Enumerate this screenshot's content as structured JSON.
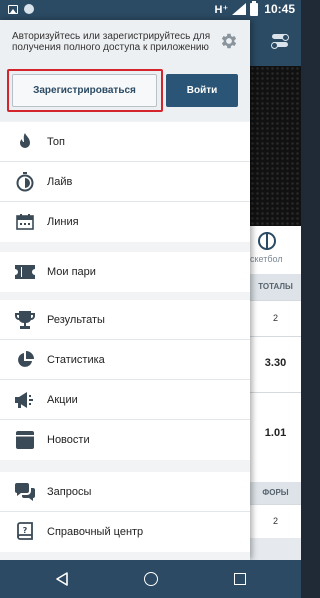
{
  "status_bar": {
    "network": "H⁺",
    "time": "10:45"
  },
  "drawer": {
    "auth_message": "Авторизуйтесь или зарегистрируйтесь для получения полного доступа к приложению",
    "register_label": "Зарегистрироваться",
    "login_label": "Войти",
    "groups": [
      {
        "items": [
          {
            "label": "Топ",
            "icon": "fire-icon"
          },
          {
            "label": "Лайв",
            "icon": "stopwatch-icon"
          },
          {
            "label": "Линия",
            "icon": "calendar-icon"
          }
        ]
      },
      {
        "items": [
          {
            "label": "Мои пари",
            "icon": "ticket-icon"
          }
        ]
      },
      {
        "items": [
          {
            "label": "Результаты",
            "icon": "trophy-icon"
          },
          {
            "label": "Статистика",
            "icon": "pie-chart-icon"
          },
          {
            "label": "Акции",
            "icon": "megaphone-icon"
          },
          {
            "label": "Новости",
            "icon": "newspaper-icon"
          }
        ]
      },
      {
        "items": [
          {
            "label": "Запросы",
            "icon": "chat-icon"
          },
          {
            "label": "Справочный центр",
            "icon": "help-book-icon"
          }
        ]
      }
    ]
  },
  "background": {
    "sport_label": "скетбол",
    "col_header": "ТОТАЛЫ",
    "row1_value": "2",
    "odds1": "3.30",
    "odds2": "1.01",
    "foru_header": "ФОРЫ",
    "row2_value": "2"
  },
  "colors": {
    "accent": "#2b5576",
    "highlight": "#d4242c"
  }
}
